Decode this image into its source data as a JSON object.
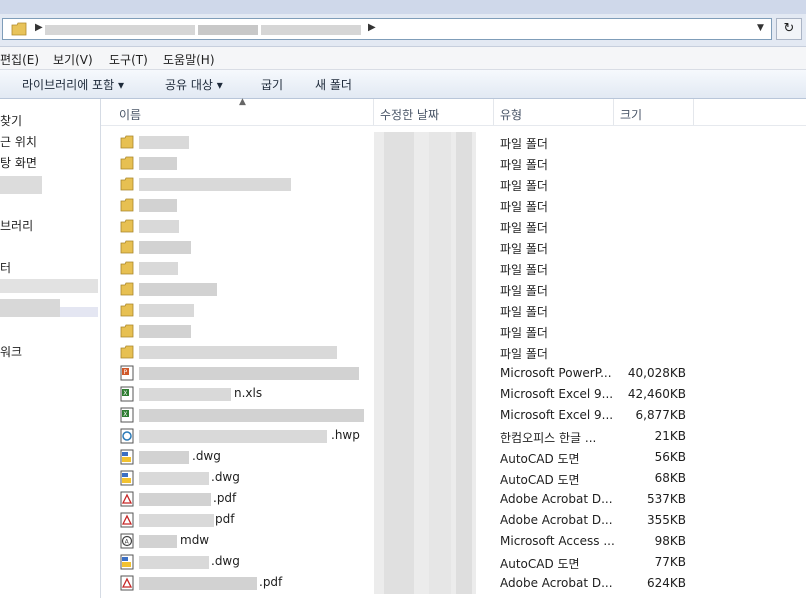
{
  "menu": [
    "편집(E)",
    "보기(V)",
    "도구(T)",
    "도움말(H)"
  ],
  "toolbar": {
    "library": "라이브러리에 포함 ▾",
    "share": "공유 대상 ▾",
    "burn": "굽기",
    "newfolder": "새 폴더"
  },
  "nav": {
    "items": [
      "찾기",
      "근 위치",
      "탕 화면",
      "브러리",
      "터",
      "워크"
    ]
  },
  "columns": {
    "name": "이름",
    "date": "수정한 날짜",
    "type": "유형",
    "size": "크기"
  },
  "rows": [
    {
      "kind": "folder",
      "ext": "",
      "type": "파일 폴더",
      "size": ""
    },
    {
      "kind": "folder",
      "ext": "",
      "type": "파일 폴더",
      "size": ""
    },
    {
      "kind": "folder",
      "ext": "",
      "type": "파일 폴더",
      "size": ""
    },
    {
      "kind": "folder",
      "ext": "",
      "type": "파일 폴더",
      "size": ""
    },
    {
      "kind": "folder",
      "ext": "",
      "type": "파일 폴더",
      "size": ""
    },
    {
      "kind": "folder",
      "ext": "",
      "type": "파일 폴더",
      "size": ""
    },
    {
      "kind": "folder",
      "ext": "",
      "type": "파일 폴더",
      "size": ""
    },
    {
      "kind": "folder",
      "ext": "",
      "type": "파일 폴더",
      "size": ""
    },
    {
      "kind": "folder",
      "ext": "",
      "type": "파일 폴더",
      "size": ""
    },
    {
      "kind": "folder",
      "ext": "",
      "type": "파일 폴더",
      "size": ""
    },
    {
      "kind": "folder",
      "ext": "",
      "type": "파일 폴더",
      "size": ""
    },
    {
      "kind": "ppt",
      "ext": "",
      "type": "Microsoft PowerP...",
      "size": "40,028KB"
    },
    {
      "kind": "xls",
      "ext": "n.xls",
      "type": "Microsoft Excel 9...",
      "size": "42,460KB"
    },
    {
      "kind": "xls",
      "ext": "",
      "type": "Microsoft Excel 9...",
      "size": "6,877KB"
    },
    {
      "kind": "hwp",
      "ext": ".hwp",
      "type": "한컴오피스 한글 ...",
      "size": "21KB"
    },
    {
      "kind": "dwg",
      "ext": ".dwg",
      "type": "AutoCAD 도면",
      "size": "56KB"
    },
    {
      "kind": "dwg",
      "ext": ".dwg",
      "type": "AutoCAD 도면",
      "size": "68KB"
    },
    {
      "kind": "pdf",
      "ext": ".pdf",
      "type": "Adobe Acrobat D...",
      "size": "537KB"
    },
    {
      "kind": "pdf",
      "ext": "pdf",
      "type": "Adobe Acrobat D...",
      "size": "355KB"
    },
    {
      "kind": "mdw",
      "ext": "mdw",
      "type": "Microsoft Access ...",
      "size": "98KB"
    },
    {
      "kind": "dwg",
      "ext": ".dwg",
      "type": "AutoCAD 도면",
      "size": "77KB"
    },
    {
      "kind": "pdf",
      "ext": ".pdf",
      "type": "Adobe Acrobat D...",
      "size": "624KB"
    }
  ]
}
